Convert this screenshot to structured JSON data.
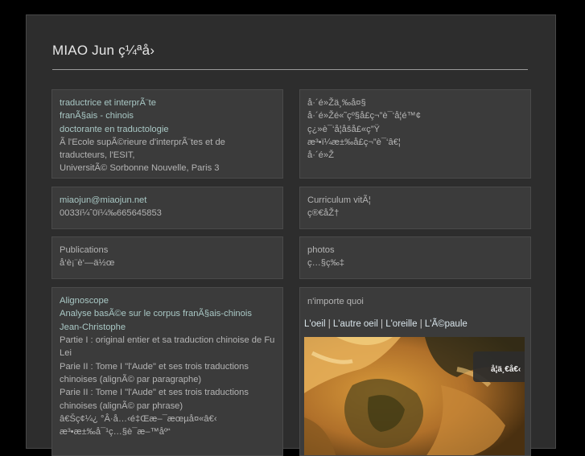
{
  "site": {
    "title": "MIAO Jun ç¼ªå›"
  },
  "profile": {
    "lines": [
      "traductrice et interprÃ¨te",
      "franÃ§ais - chinois",
      "doctorante en traductologie",
      "Ã  l'Ecole supÃ©rieure d'interprÃ¨tes et de",
      "traducteurs, l'ESIT,",
      "UniversitÃ© Sorbonne Nouvelle, Paris 3"
    ]
  },
  "lang_block": {
    "lines": [
      "å·´é»Žä¸‰å¤§",
      "å·´é»Žé«˜çº§å£ç¬”è¯‘å­¦é™¢",
      "ç¿»è¯‘å­¦åšå£«ç”Ÿ",
      "æ³•ï¼æ±‰å£ç¬”è¯‘â€¦",
      "å·´é»Ž"
    ]
  },
  "contact": {
    "email": "miaojun@miaojun.net",
    "phone": "0033ï¼ˆ0ï¼‰665645853"
  },
  "cv": {
    "title": "Curriculum vitÃ¦",
    "subtitle": "ç®€åŽ†"
  },
  "publications": {
    "title": "Publications",
    "subtitle": "å‘è¡¨è‘—ä½œ"
  },
  "photos": {
    "title": "photos",
    "subtitle": "ç…§ç‰‡"
  },
  "alignoscope": {
    "title": "Alignoscope",
    "subtitle": "Analyse basÃ©e sur le corpus franÃ§ais-chinois",
    "author": "Jean-Christophe",
    "part1": "Partie I : original entier et sa traduction chinoise de Fu Lei",
    "part2a": "Parie II : Tome I \"l'Aude\" et ses trois traductions chinoises (alignÃ© par paragraphe)",
    "part2b": "Parie II : Tome I \"l'Aude\" et ses trois traductions chinoises (alignÃ© par phrase)",
    "zh1": "â€Šç¢¼¿ °Â·å…‹é‡Œæ–¯æœµå¤«â€‹",
    "zh2": "æ³•æ±‰å¯¹ç…§è¯­æ–™åº“"
  },
  "misc": {
    "title": "n'importe quoi",
    "links": [
      "L'oeil",
      "L'autre oeil",
      "L'oreille",
      "L'Ã©paule"
    ],
    "separator": "|",
    "caption": "å¦ä¸€å€‹"
  }
}
